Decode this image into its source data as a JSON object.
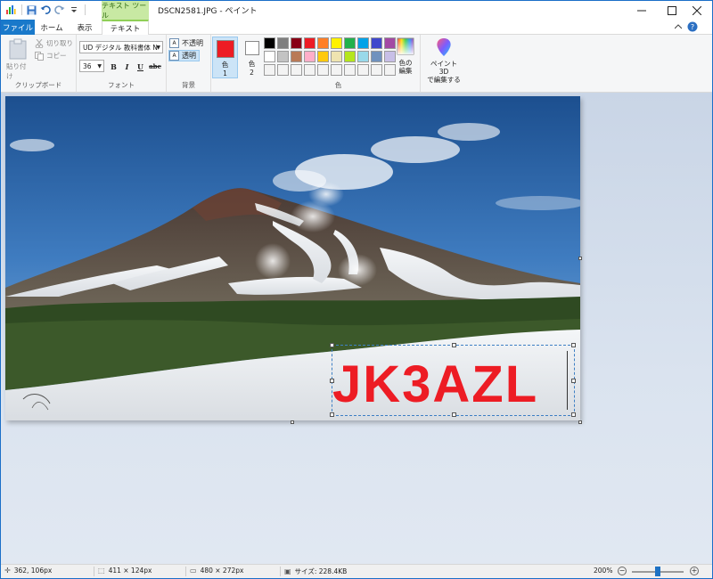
{
  "window": {
    "title": "DSCN2581.JPG - ペイント",
    "context_tab": "テキスト ツール"
  },
  "tabs": [
    {
      "label": "ファイル"
    },
    {
      "label": "ホーム"
    },
    {
      "label": "表示"
    },
    {
      "label": "テキスト"
    }
  ],
  "ribbon": {
    "clipboard": {
      "paste": "貼り付け",
      "cut": "切り取り",
      "copy": "コピー",
      "label": "クリップボード"
    },
    "font": {
      "family": "UD デジタル 教科書体 N",
      "size": "36",
      "bold": "B",
      "italic": "I",
      "underline": "U",
      "strike": "abc",
      "label": "フォント"
    },
    "background": {
      "opaque": "不透明",
      "transparent": "透明",
      "label": "背景"
    },
    "colors": {
      "color1_label": "色",
      "color1_num": "1",
      "color2_label": "色",
      "color2_num": "2",
      "color1": "#ed1c24",
      "color2": "#ffffff",
      "edit_label_1": "色の",
      "edit_label_2": "編集",
      "label": "色",
      "palette": [
        "#000000",
        "#7f7f7f",
        "#880015",
        "#ed1c24",
        "#ff7f27",
        "#fff200",
        "#22b14c",
        "#00a2e8",
        "#3f48cc",
        "#a349a4",
        "#ffffff",
        "#c3c3c3",
        "#b97a57",
        "#ffaec9",
        "#ffc90e",
        "#efe4b0",
        "#b5e61d",
        "#99d9ea",
        "#7092be",
        "#c8bfe7",
        "#f3f3f3",
        "#f3f3f3",
        "#f3f3f3",
        "#f3f3f3",
        "#f3f3f3",
        "#f3f3f3",
        "#f3f3f3",
        "#f3f3f3",
        "#f3f3f3",
        "#f3f3f3"
      ]
    },
    "paint3d": {
      "line1": "ペイント 3D",
      "line2": "で編集する"
    }
  },
  "canvas": {
    "text": "JK3AZL",
    "text_color": "#ed1c24"
  },
  "status": {
    "cursor": "362, 106px",
    "selection": "411 × 124px",
    "image_size": "480 × 272px",
    "file_size": "サイズ: 228.4KB",
    "zoom": "200%",
    "zoom_fraction": 0.5
  }
}
